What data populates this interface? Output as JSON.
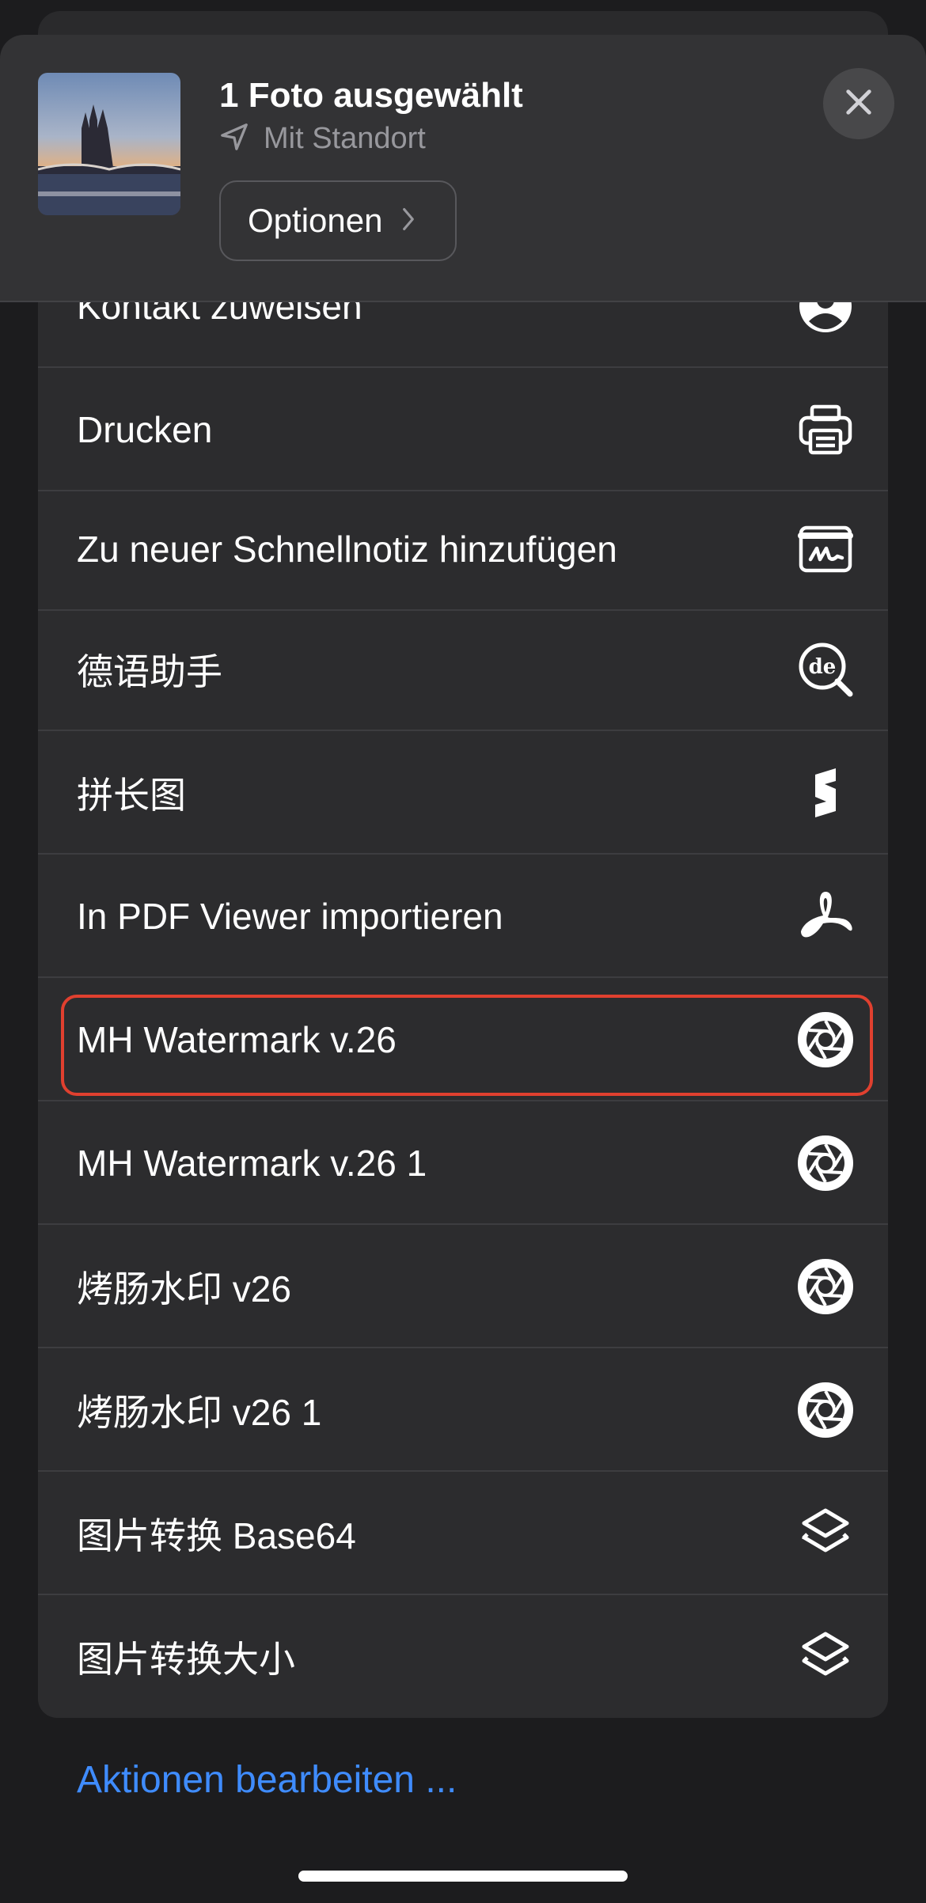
{
  "header": {
    "title": "1 Foto ausgewählt",
    "location": "Mit Standort",
    "options_label": "Optionen"
  },
  "actions": [
    {
      "label": "Kontakt zuweisen",
      "icon": "person-circle-icon"
    },
    {
      "label": "Drucken",
      "icon": "printer-icon"
    },
    {
      "label": "Zu neuer Schnellnotiz hinzufügen",
      "icon": "quick-note-icon"
    },
    {
      "label": "德语助手",
      "icon": "de-search-icon"
    },
    {
      "label": "拼长图",
      "icon": "s-shape-icon"
    },
    {
      "label": "In PDF Viewer importieren",
      "icon": "pdf-viewer-icon"
    },
    {
      "label": "MH Watermark v.26",
      "icon": "aperture-icon"
    },
    {
      "label": "MH Watermark v.26 1",
      "icon": "aperture-icon"
    },
    {
      "label": "烤肠水印 v26",
      "icon": "aperture-icon"
    },
    {
      "label": "烤肠水印 v26 1",
      "icon": "aperture-icon"
    },
    {
      "label": "图片转换 Base64",
      "icon": "shortcuts-icon"
    },
    {
      "label": "图片转换大小",
      "icon": "shortcuts-icon"
    }
  ],
  "edit_actions_label": "Aktionen bearbeiten ...",
  "colors": {
    "background": "#1c1c1e",
    "card": "#2c2c2e",
    "link": "#3f8cff",
    "highlight": "#e0402f"
  }
}
